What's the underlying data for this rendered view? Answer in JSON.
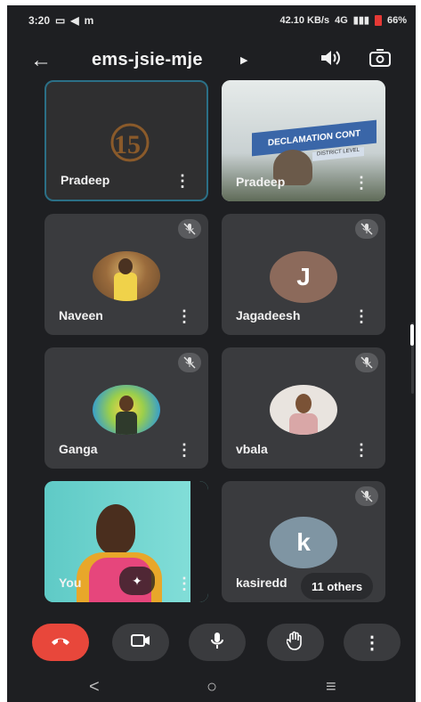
{
  "status_bar": {
    "time": "3:20",
    "network_speed": "42.10 KB/s",
    "network_type": "4G",
    "battery": "66%"
  },
  "header": {
    "back_icon": "arrow-left-icon",
    "title": "ems-jsie-mje",
    "speaker_icon": "speaker-icon",
    "switch_camera_icon": "switch-camera-icon"
  },
  "tiles": [
    {
      "name": "Pradeep",
      "type": "logo",
      "muted": false,
      "logo_text": "15"
    },
    {
      "name": "Pradeep",
      "type": "video",
      "muted": false,
      "banner_text": "DECLAMATION CONT",
      "banner_sub": "DISTRICT LEVEL"
    },
    {
      "name": "Naveen",
      "type": "photo",
      "muted": true
    },
    {
      "name": "Jagadeesh",
      "type": "letter",
      "letter": "J",
      "avatar_color": "#8c6a5b",
      "muted": true
    },
    {
      "name": "Ganga",
      "type": "photo",
      "muted": true
    },
    {
      "name": "vbala",
      "type": "photo",
      "muted": true
    },
    {
      "name": "You",
      "type": "self-video",
      "muted": false
    },
    {
      "name": "kasiredd",
      "type": "letter",
      "letter": "k",
      "avatar_color": "#7f95a3",
      "muted": true
    }
  ],
  "others_chip": "11 others",
  "controls": {
    "end_call_icon": "end-call-icon",
    "camera_icon": "camera-icon",
    "mic_icon": "mic-icon",
    "raise_hand_icon": "raise-hand-icon",
    "more_icon": "more-vert-icon"
  },
  "nav": {
    "back": "<",
    "home": "○",
    "recents": "≡"
  },
  "colors": {
    "background": "#1e1f22",
    "tile": "#3a3b3e",
    "active_border": "#2b6f86",
    "end_call": "#e8473b"
  }
}
